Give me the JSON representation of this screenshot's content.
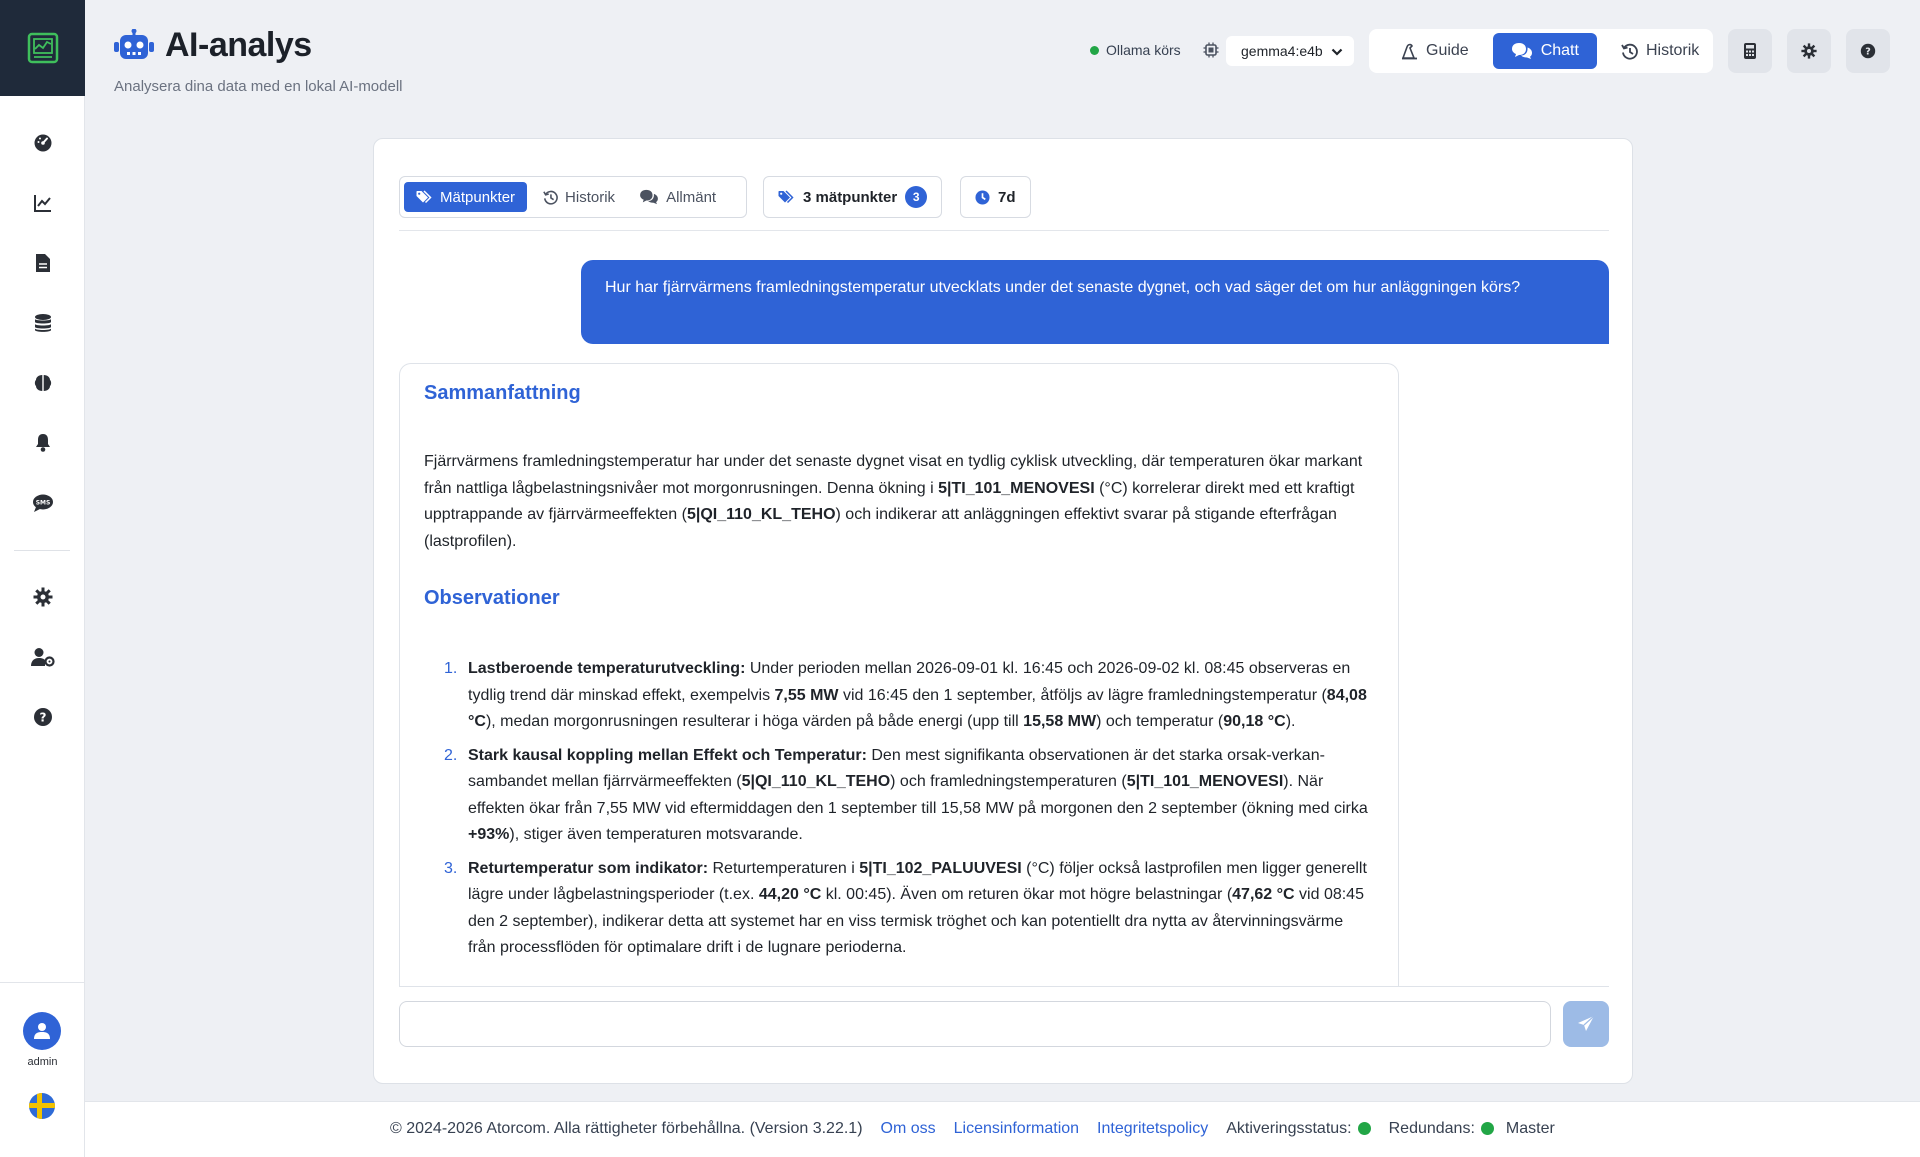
{
  "app": {
    "title": "AI-analys",
    "subtitle": "Analysera dina data med en lokal AI-modell"
  },
  "status": {
    "ollama": "Ollama körs",
    "model_selected": "gemma4:e4b"
  },
  "topnav": {
    "guide": "Guide",
    "chat": "Chatt",
    "history": "Historik"
  },
  "sidebar": {
    "items": [
      "dashboard-icon",
      "chart-line-icon",
      "document-icon",
      "database-icon",
      "brain-icon",
      "bell-icon",
      "sms-icon",
      "gear-icon",
      "user-settings-icon",
      "help-icon"
    ],
    "user": "admin"
  },
  "chat": {
    "tabs": [
      "Mätpunkter",
      "Historik",
      "Allmänt"
    ],
    "points_label": "3 mätpunkter",
    "points_count": "3",
    "range": "7d",
    "user_message": "Hur har fjärrvärmens framledningstemperatur utvecklats under det senaste dygnet, och vad säger det om hur anläggningen körs?",
    "answer": {
      "h_summary": "Sammanfattning",
      "summary": {
        "t1": "Fjärrvärmens framledningstemperatur har under det senaste dygnet visat en tydlig cyklisk utveckling, där temperaturen ökar markant från nattliga lågbelastningsnivåer mot morgonrusningen. Denna ökning i ",
        "b1": "5|TI_101_MENOVESI",
        "t2": " (°C) korrelerar direkt med ett kraftigt upptrappande av fjärrvärmeeffekten (",
        "b2": "5|QI_110_KL_TEHO",
        "t3": ") och indikerar att anläggningen effektivt svarar på stigande efterfrågan (lastprofilen)."
      },
      "h_obs": "Observationer",
      "obs": [
        {
          "num": "1.",
          "title": "Lastberoende temperaturutveckling:",
          "t1": " Under perioden mellan 2026-09-01 kl. 16:45 och 2026-09-02 kl. 08:45 observeras en tydlig trend där minskad effekt, exempelvis ",
          "b1": "7,55 MW",
          "t2": " vid 16:45 den 1 september, åtföljs av lägre framledningstemperatur (",
          "b2": "84,08 °C",
          "t3": "), medan morgonrusningen resulterar i höga värden på både energi (upp till ",
          "b3": "15,58 MW",
          "t4": ") och temperatur (",
          "b4": "90,18 °C",
          "t5": ")."
        },
        {
          "num": "2.",
          "title": "Stark kausal koppling mellan Effekt och Temperatur:",
          "t1": " Den mest signifikanta observationen är det starka orsak-verkan-sambandet mellan fjärrvärmeeffekten (",
          "b1": "5|QI_110_KL_TEHO",
          "t2": ") och framledningstemperaturen (",
          "b2": "5|TI_101_MENOVESI",
          "t3": "). När effekten ökar från 7,55 MW vid eftermiddagen den 1 september till 15,58 MW på morgonen den 2 september (ökning med cirka ",
          "b3": "+93%",
          "t4": "), stiger även temperaturen motsvarande."
        },
        {
          "num": "3.",
          "title": "Returtemperatur som indikator:",
          "t1": " Returtemperaturen i ",
          "b1": "5|TI_102_PALUUVESI",
          "t2": " (°C) följer också lastprofilen men ligger generellt lägre under lågbelastningsperioder (t.ex. ",
          "b2": "44,20 °C",
          "t3": " kl. 00:45). Även om returen ökar mot högre belastningar (",
          "b3": "47,62 °C",
          "t4": " vid 08:45 den 2 september), indikerar detta att systemet har en viss termisk tröghet och kan potentiellt dra nytta av återvinningsvärme från processflöden för optimalare drift i de lugnare perioderna."
        }
      ]
    },
    "input_placeholder": ""
  },
  "footer": {
    "copyright": "© 2024-2026 Atorcom. Alla rättigheter förbehållna. (Version 3.22.1)",
    "about": "Om oss",
    "license": "Licensinformation",
    "privacy": "Integritetspolicy",
    "activation": "Aktiveringsstatus:",
    "redundancy": "Redundans:",
    "master": "Master"
  },
  "colors": {
    "accent": "#2f63d6",
    "status_ok": "#22a646"
  }
}
